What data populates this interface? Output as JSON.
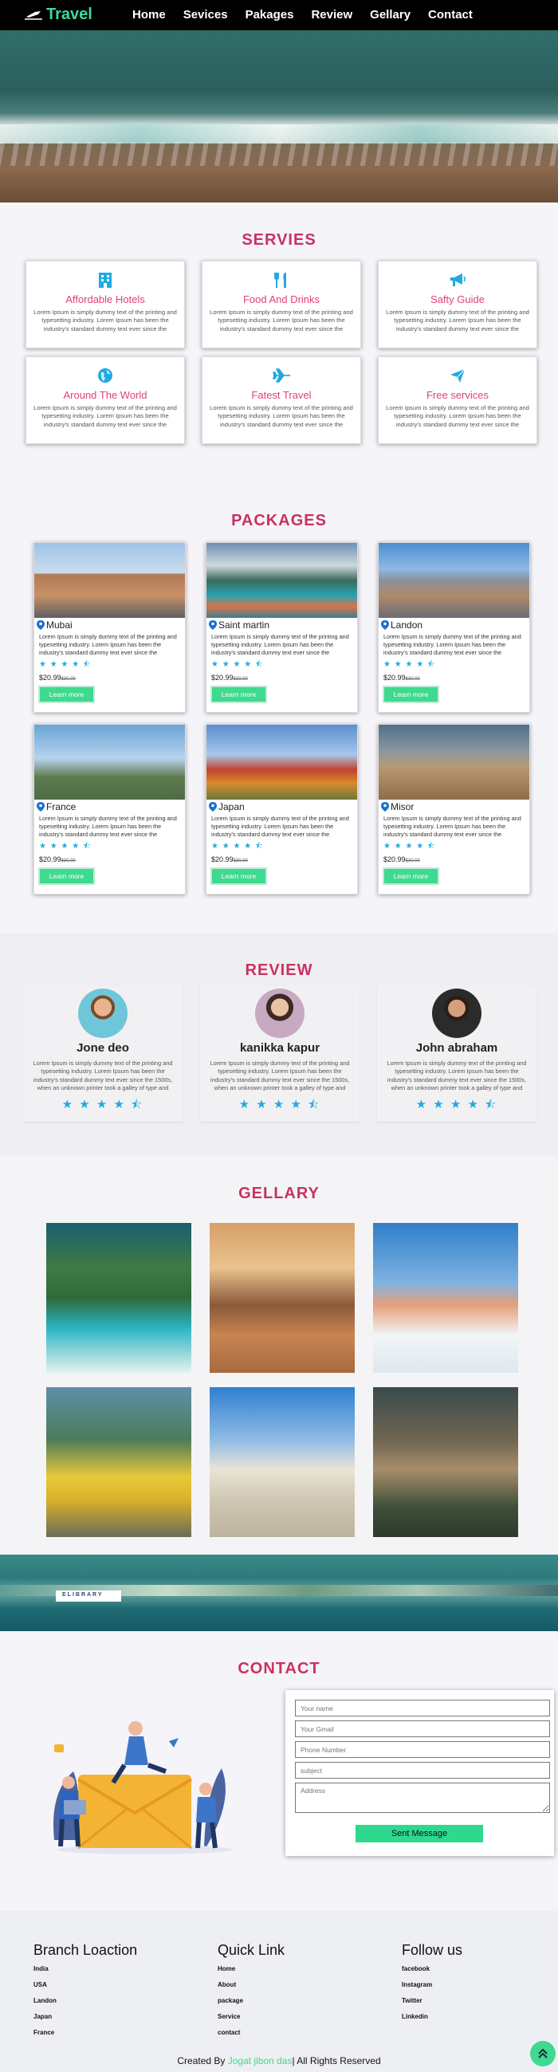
{
  "nav": {
    "logo": "Travel",
    "items": [
      "Home",
      "Sevices",
      "Pakages",
      "Review",
      "Gellary",
      "Contact"
    ]
  },
  "services": {
    "title": "SERVIES",
    "items": [
      {
        "title": "Affordable Hotels",
        "icon": "building-icon",
        "text": "Lorem Ipsum is simply dummy text of the printing and typesetting industry. Lorem Ipsum has been the industry's standard dummy text ever since the"
      },
      {
        "title": "Food And Drinks",
        "icon": "utensils-icon",
        "text": "Lorem Ipsum is simply dummy text of the printing and typesetting industry. Lorem Ipsum has been the industry's standard dummy text ever since the"
      },
      {
        "title": "Safty Guide",
        "icon": "bullhorn-icon",
        "text": "Lorem Ipsum is simply dummy text of the printing and typesetting industry. Lorem Ipsum has been the industry's standard dummy text ever since the"
      },
      {
        "title": "Around The World",
        "icon": "globe-icon",
        "text": "Lorem Ipsum is simply dummy text of the printing and typesetting industry. Lorem Ipsum has been the industry's standard dummy text ever since the"
      },
      {
        "title": "Fatest Travel",
        "icon": "plane-icon",
        "text": "Lorem Ipsum is simply dummy text of the printing and typesetting industry. Lorem Ipsum has been the industry's standard dummy text ever since the"
      },
      {
        "title": "Free services",
        "icon": "send-icon",
        "text": "Lorem Ipsum is simply dummy text of the printing and typesetting industry. Lorem Ipsum has been the industry's standard dummy text ever since the"
      }
    ]
  },
  "packages": {
    "title": "PACKAGES",
    "button": "Learn more",
    "price": "$20.99",
    "old_price": "$30.00",
    "rating": 4.5,
    "text": "Lorem Ipsum is simply dummy text of the printing and typesetting industry. Lorem Ipsum has been the industry's standard dummy text ever since the",
    "places": [
      "Mubai",
      "Saint martin",
      "Landon",
      "France",
      "Japan",
      "Misor"
    ]
  },
  "review": {
    "title": "REVIEW",
    "text": "Lorem Ipsum is simply dummy text of the printing and typesetting industry. Lorem Ipsum has been the industry's standard dummy text ever since the 1500s, when an unknown printer took a galley of type and scrambled",
    "rating": 4.5,
    "people": [
      "Jone deo",
      "kanikka kapur",
      "John abraham"
    ]
  },
  "gallery": {
    "title": "GELLARY"
  },
  "banner": {
    "label": "ELIBRARY"
  },
  "contact": {
    "title": "CONTACT",
    "placeholders": {
      "name": "Your name",
      "email": "Your Gmail",
      "phone": "Phone Number",
      "subject": "subject",
      "address": "Address"
    },
    "button": "Sent Message"
  },
  "footer": {
    "branch_title": "Branch Loaction",
    "branches": [
      "India",
      "USA",
      "Landon",
      "Japan",
      "France"
    ],
    "quick_title": "Quick Link",
    "links": [
      "Home",
      "About",
      "package",
      "Service",
      "contact"
    ],
    "follow_title": "Follow us",
    "socials": [
      "facebook",
      "Instagram",
      "Twitter",
      "Linkedin"
    ],
    "credit_prefix": "Created By",
    "credit_author": "Jogat jibon das",
    "credit_suffix": "| All Rights Reserved"
  },
  "colors": {
    "accent": "#c8325f",
    "service_title": "#e0417a",
    "icon": "#21a9e1",
    "button": "#3fd98f"
  }
}
